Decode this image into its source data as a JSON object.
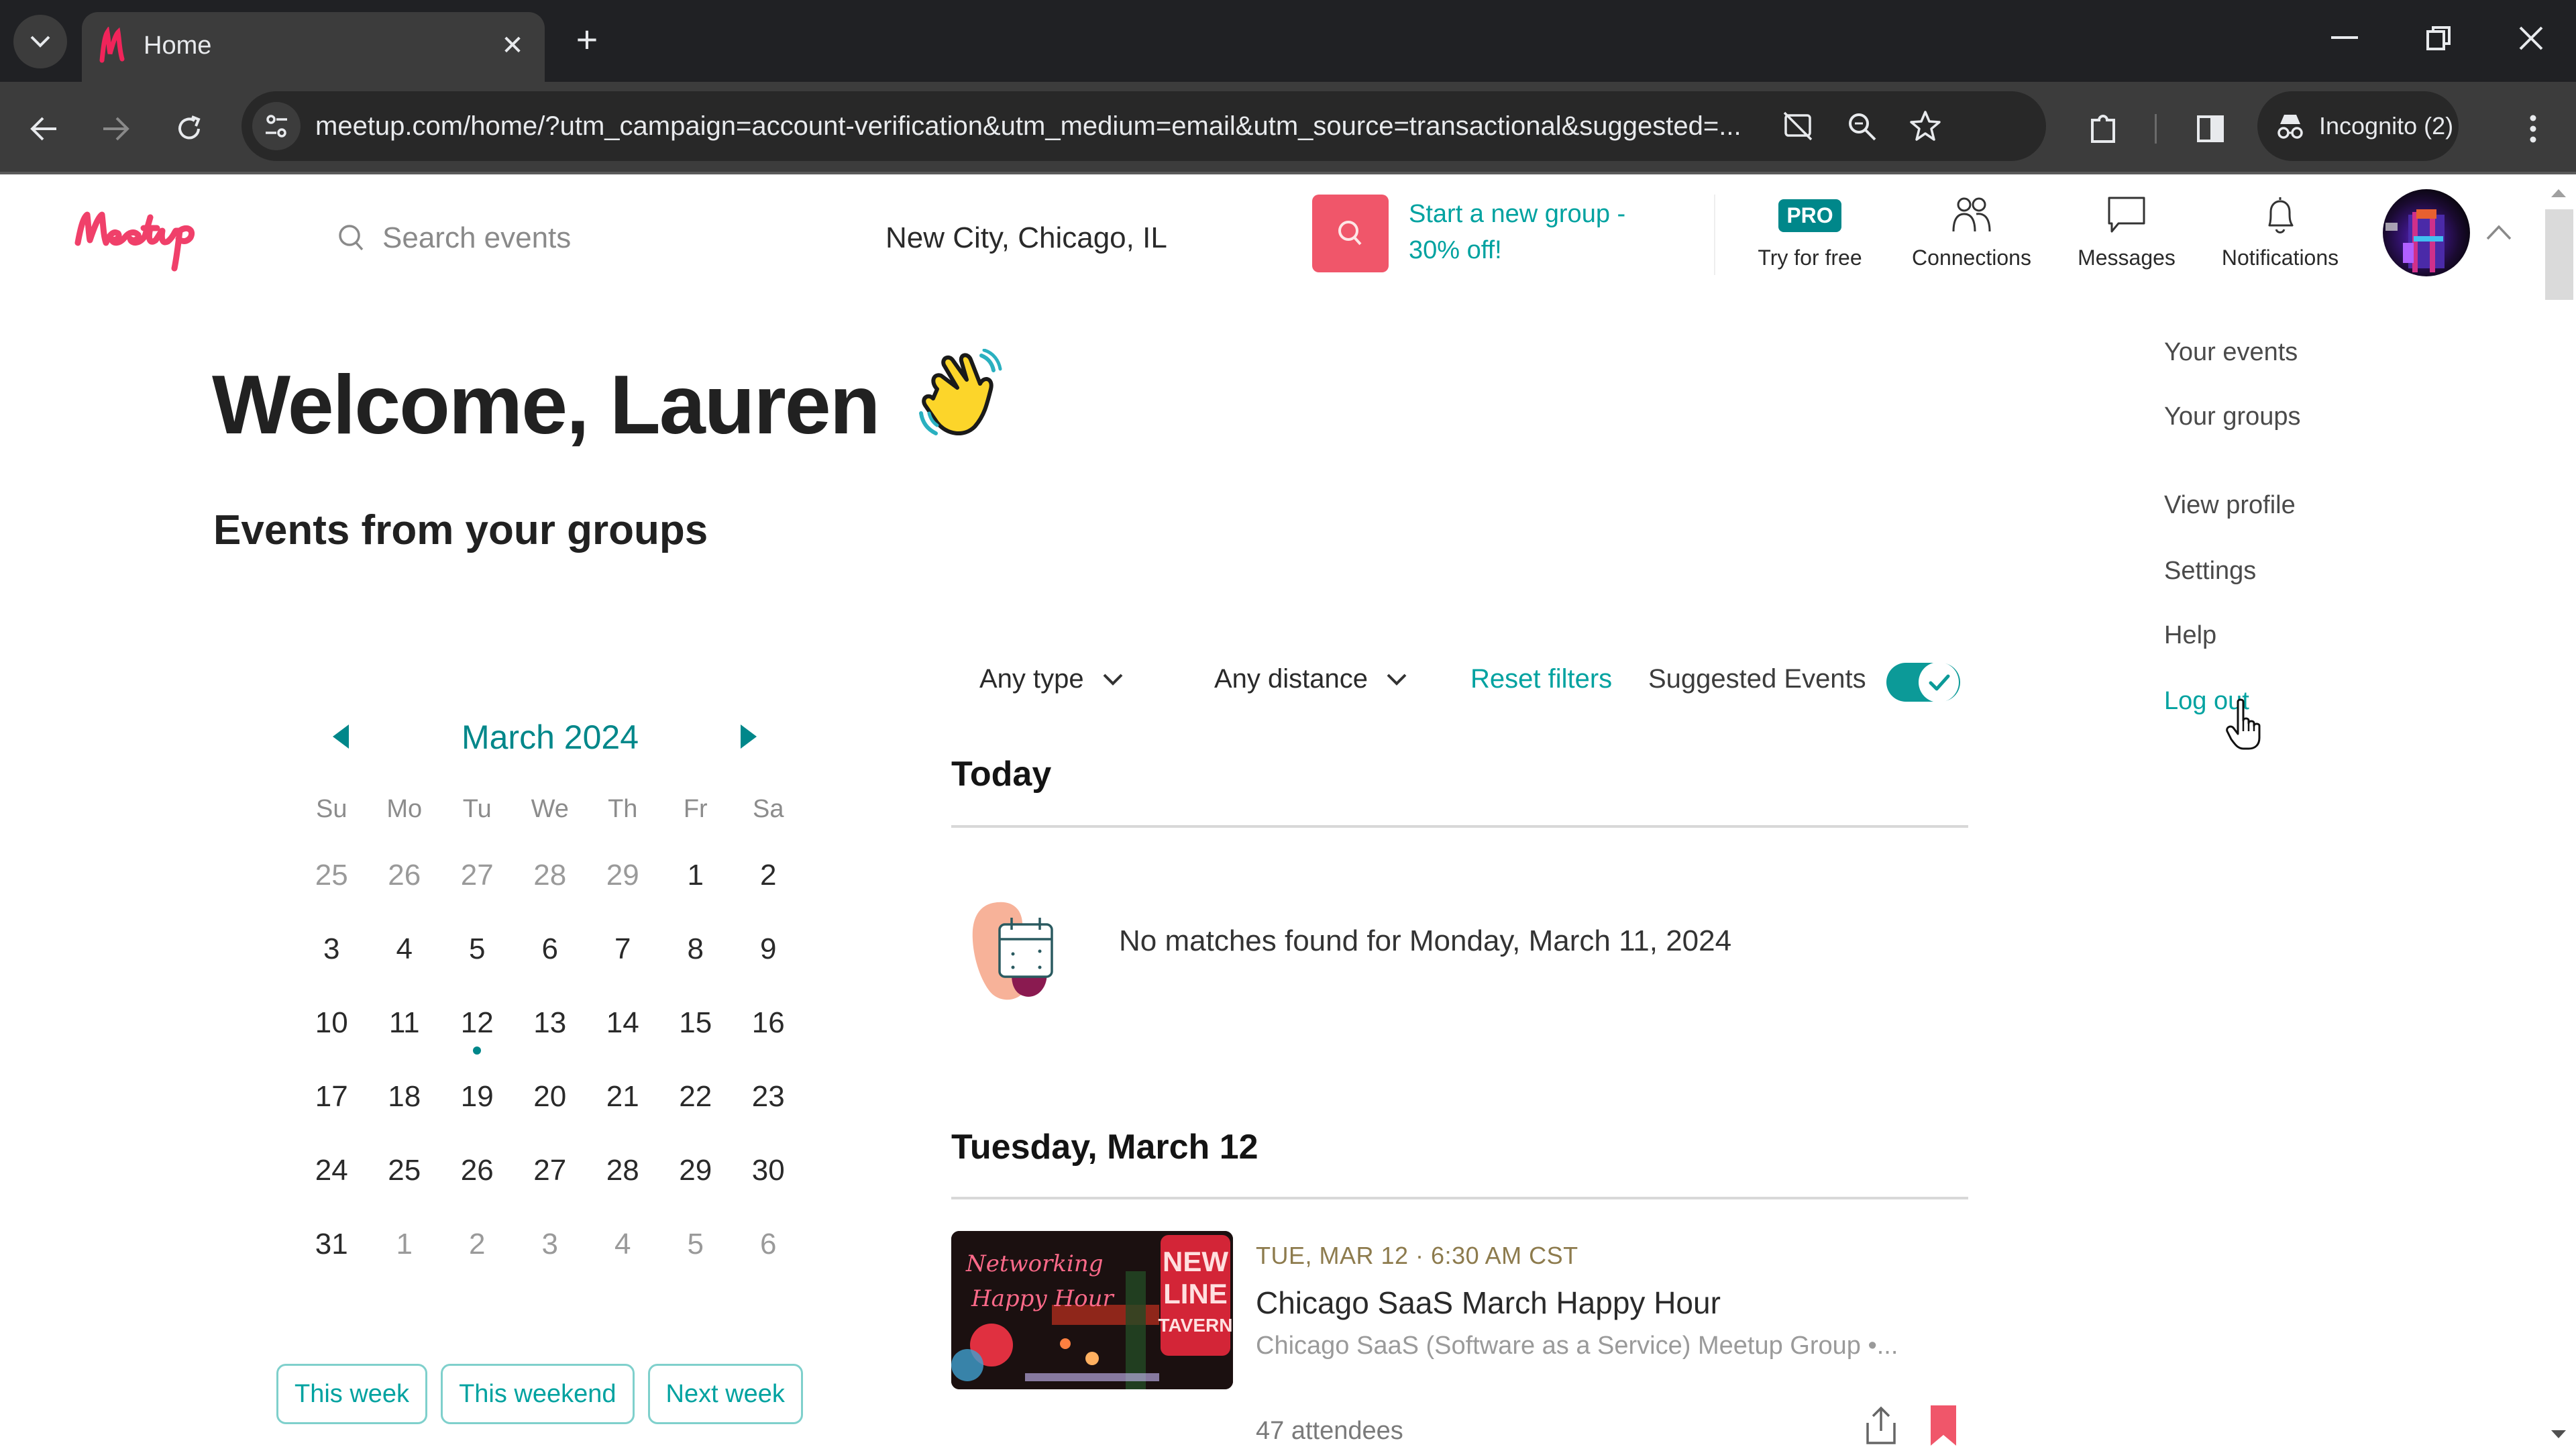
{
  "browser": {
    "tab": {
      "title": "Home",
      "favicon": "meetup-favicon"
    },
    "url": "meetup.com/home/?utm_campaign=account-verification&utm_medium=email&utm_source=transactional&suggested=...",
    "incognito_label": "Incognito (2)",
    "colors": {
      "chrome_dark": "#202124",
      "chrome_toolbar": "#3c3c3c"
    }
  },
  "header": {
    "logo_text": "Meetup",
    "search_placeholder": "Search events",
    "location_value": "New City, Chicago, IL",
    "promo_line1": "Start a new group -",
    "promo_line2": "30% off!",
    "pro_badge": "PRO",
    "nav": [
      {
        "label": "Try for free",
        "icon": "pro-badge"
      },
      {
        "label": "Connections",
        "icon": "people-icon"
      },
      {
        "label": "Messages",
        "icon": "chat-bubble-icon"
      },
      {
        "label": "Notifications",
        "icon": "bell-icon"
      }
    ],
    "colors": {
      "brand": "#f65858",
      "search_button": "#f0566a",
      "teal": "#00a2a0",
      "teal_dark": "#00878a"
    }
  },
  "main": {
    "welcome": "Welcome, Lauren",
    "section_title": "Events from your groups"
  },
  "calendar": {
    "month_label": "March 2024",
    "weekdays": [
      "Su",
      "Mo",
      "Tu",
      "We",
      "Th",
      "Fr",
      "Sa"
    ],
    "weeks": [
      [
        {
          "d": "25",
          "muted": true
        },
        {
          "d": "26",
          "muted": true
        },
        {
          "d": "27",
          "muted": true
        },
        {
          "d": "28",
          "muted": true
        },
        {
          "d": "29",
          "muted": true
        },
        {
          "d": "1"
        },
        {
          "d": "2"
        }
      ],
      [
        {
          "d": "3"
        },
        {
          "d": "4"
        },
        {
          "d": "5"
        },
        {
          "d": "6"
        },
        {
          "d": "7"
        },
        {
          "d": "8"
        },
        {
          "d": "9"
        }
      ],
      [
        {
          "d": "10"
        },
        {
          "d": "11"
        },
        {
          "d": "12",
          "has_event": true
        },
        {
          "d": "13"
        },
        {
          "d": "14"
        },
        {
          "d": "15"
        },
        {
          "d": "16"
        }
      ],
      [
        {
          "d": "17"
        },
        {
          "d": "18"
        },
        {
          "d": "19"
        },
        {
          "d": "20"
        },
        {
          "d": "21"
        },
        {
          "d": "22"
        },
        {
          "d": "23"
        }
      ],
      [
        {
          "d": "24"
        },
        {
          "d": "25"
        },
        {
          "d": "26"
        },
        {
          "d": "27"
        },
        {
          "d": "28"
        },
        {
          "d": "29"
        },
        {
          "d": "30"
        }
      ],
      [
        {
          "d": "31"
        },
        {
          "d": "1",
          "muted": true
        },
        {
          "d": "2",
          "muted": true
        },
        {
          "d": "3",
          "muted": true
        },
        {
          "d": "4",
          "muted": true
        },
        {
          "d": "5",
          "muted": true
        },
        {
          "d": "6",
          "muted": true
        }
      ]
    ],
    "quick_filters": [
      "This week",
      "This weekend",
      "Next week"
    ]
  },
  "filters": {
    "type": "Any type",
    "distance": "Any distance",
    "reset": "Reset filters",
    "suggested_label": "Suggested Events",
    "suggested_enabled": true
  },
  "events": {
    "today_heading": "Today",
    "empty_message": "No matches found for Monday, March 11, 2024",
    "day2_heading": "Tuesday, March 12",
    "items": [
      {
        "date": "TUE, MAR 12 · 6:30 AM CST",
        "title": "Chicago SaaS March Happy Hour",
        "group": "Chicago SaaS (Software as a Service) Meetup Group •...",
        "attendees": "47 attendees",
        "image_text": [
          "Networking",
          "Happy Hour",
          "NEW LINE TAVERN"
        ],
        "saved": true
      }
    ]
  },
  "profile_menu": {
    "items": [
      {
        "label": "Your events"
      },
      {
        "label": "Your groups"
      },
      {
        "label": "View profile"
      },
      {
        "label": "Settings"
      },
      {
        "label": "Help"
      },
      {
        "label": "Log out",
        "hovered": true
      }
    ]
  }
}
